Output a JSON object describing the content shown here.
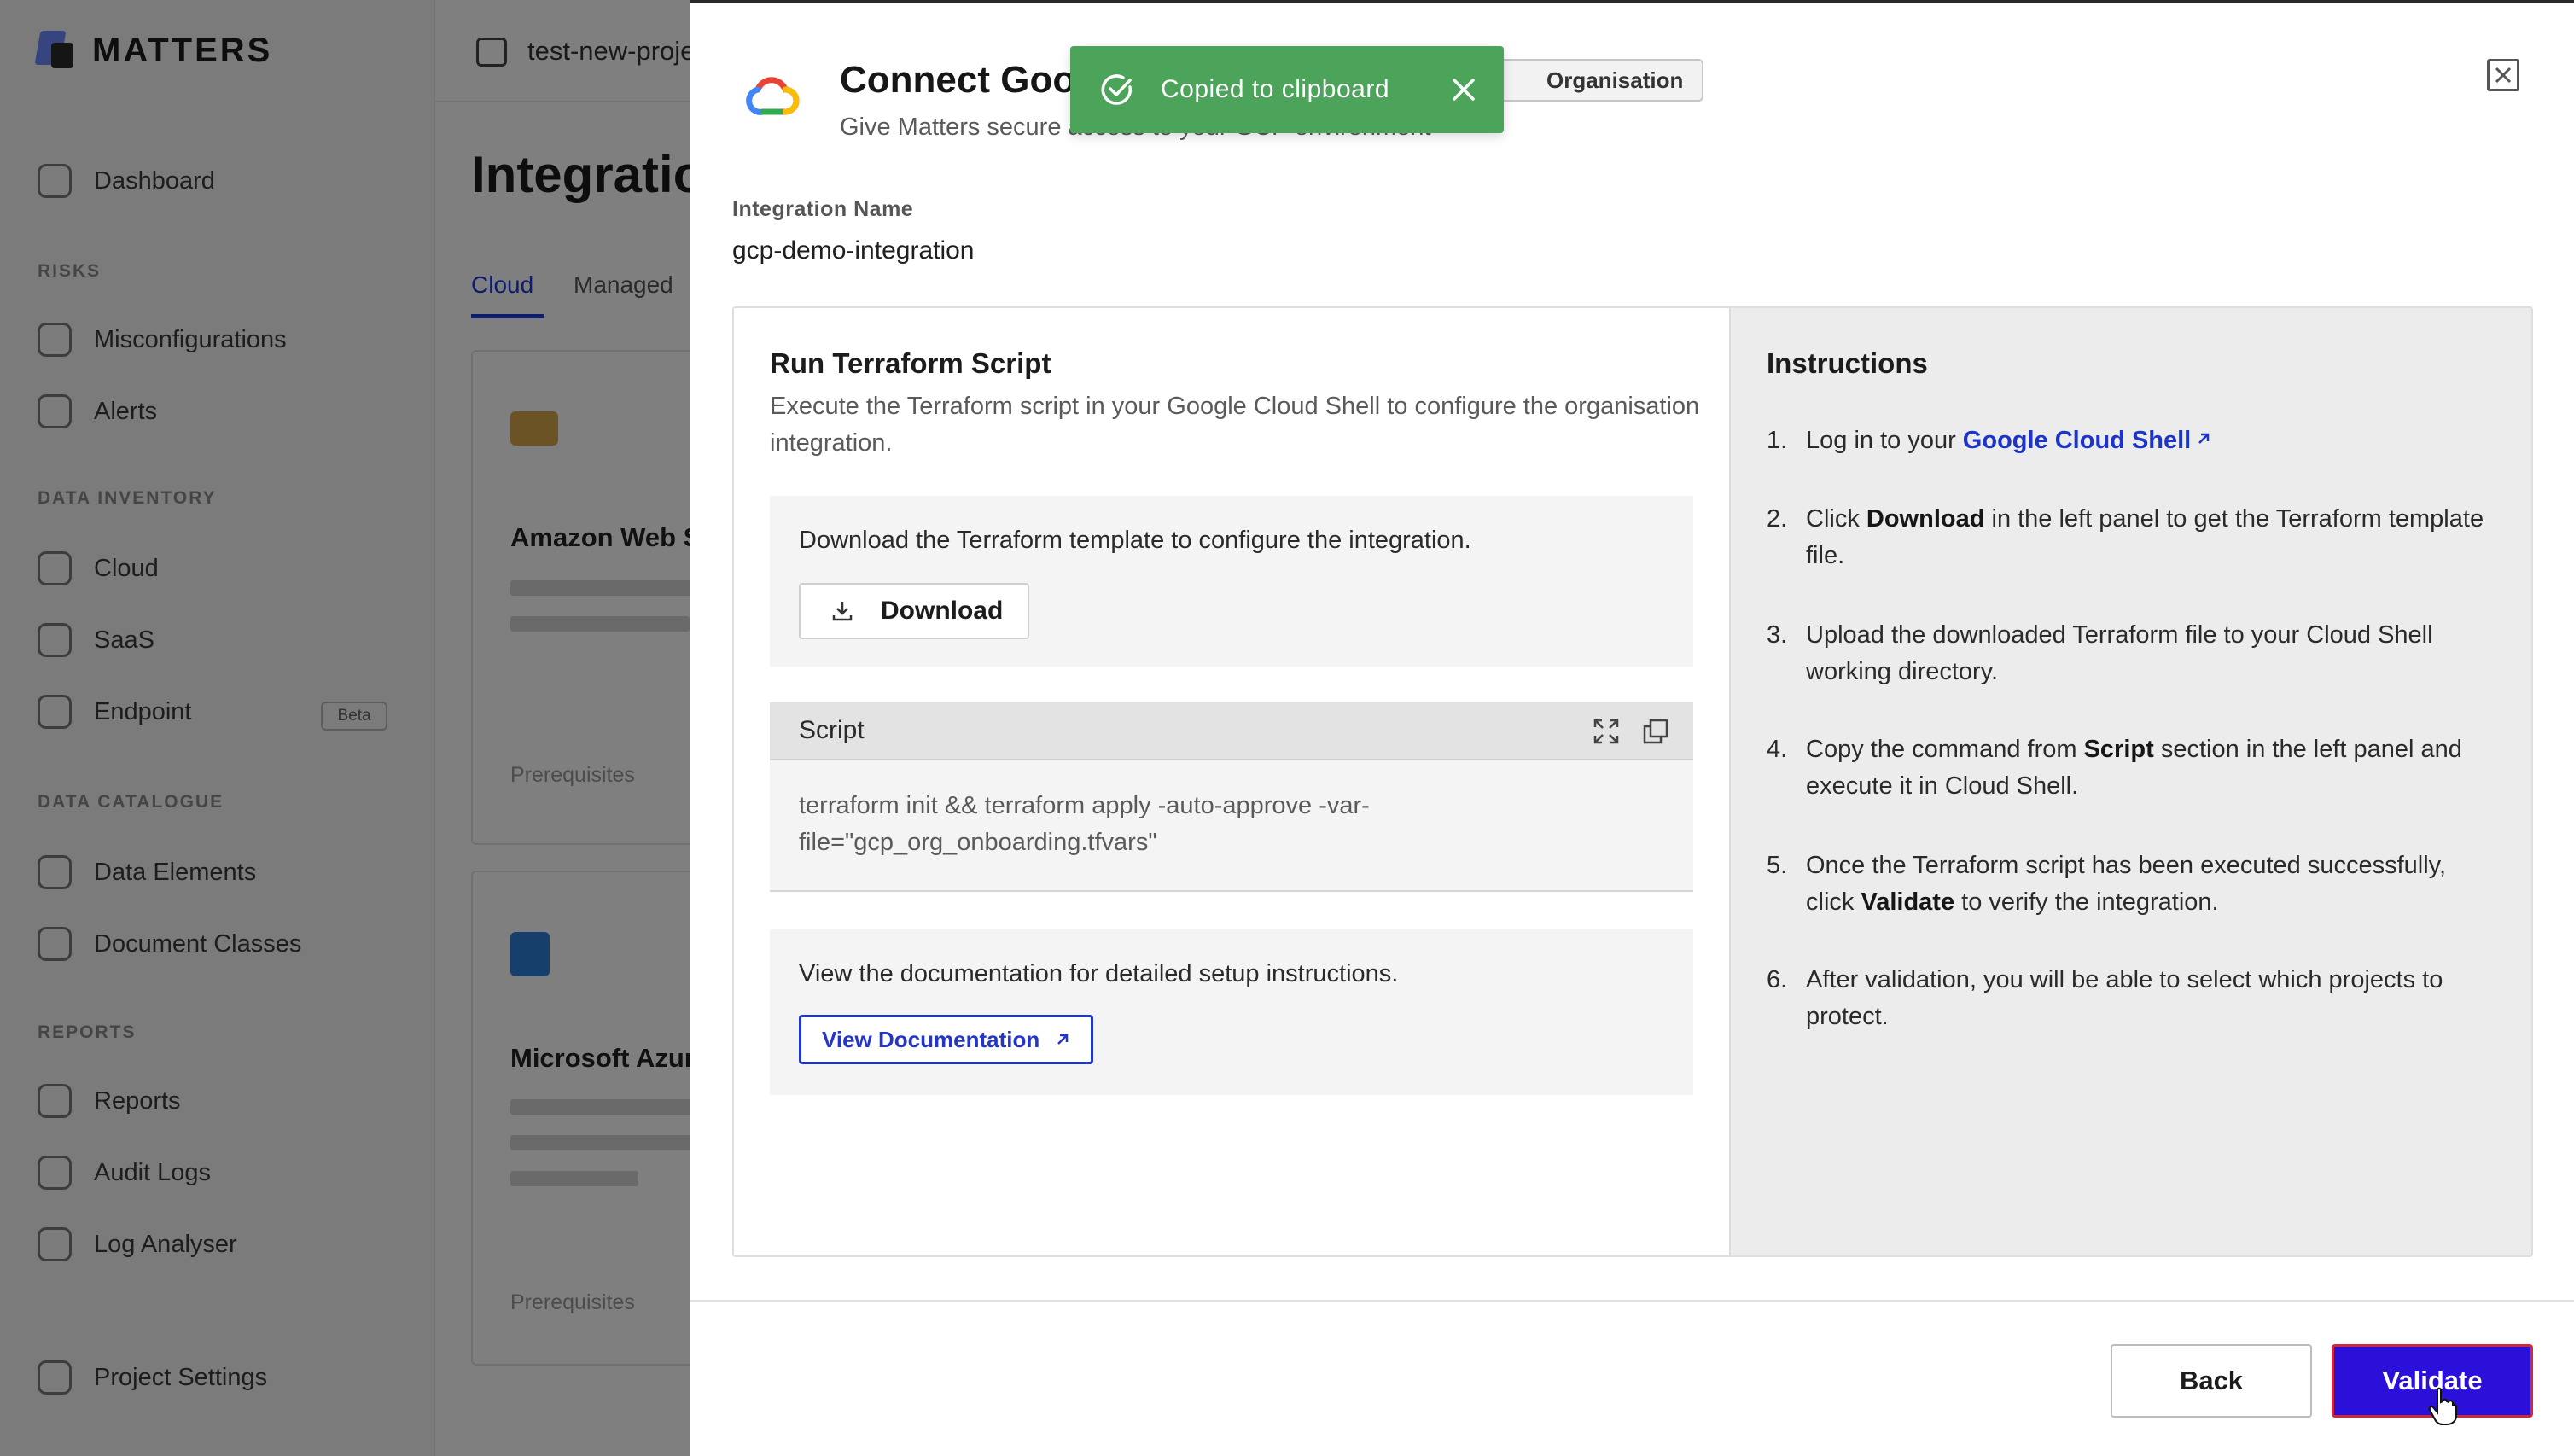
{
  "background": {
    "brand": "MATTERS",
    "topbar_text": "test-new-project",
    "page_title": "Integrations",
    "tabs": [
      {
        "label": "Cloud",
        "active": true
      },
      {
        "label": "Managed",
        "active": false
      }
    ],
    "sidebar": {
      "items": [
        {
          "label": "Dashboard"
        },
        {
          "section": "RISKS"
        },
        {
          "label": "Misconfigurations"
        },
        {
          "label": "Alerts"
        },
        {
          "section": "DATA INVENTORY"
        },
        {
          "label": "Cloud"
        },
        {
          "label": "SaaS"
        },
        {
          "label": "Endpoint",
          "badge": "Beta"
        },
        {
          "section": "DATA CATALOGUE"
        },
        {
          "label": "Data Elements"
        },
        {
          "label": "Document Classes"
        },
        {
          "section": "REPORTS"
        },
        {
          "label": "Reports"
        },
        {
          "label": "Audit Logs"
        },
        {
          "label": "Log Analyser"
        },
        {
          "label": "Project Settings"
        }
      ]
    },
    "cards": [
      {
        "title": "Amazon Web Services",
        "footer": "Prerequisites"
      },
      {
        "title": "Microsoft Azure",
        "footer": "Prerequisites"
      }
    ]
  },
  "drawer": {
    "title": "Connect Google Cloud Platform",
    "scope_badge": "Organisation",
    "subtitle": "Give Matters secure access to your GCP environment",
    "integration_name_label": "Integration Name",
    "integration_name_value": "gcp-demo-integration",
    "left": {
      "title": "Run Terraform Script",
      "description": "Execute the Terraform script in your Google Cloud Shell to configure the organisation integration.",
      "download_text": "Download the Terraform template to configure the integration.",
      "download_label": "Download",
      "script_label": "Script",
      "script_code": "terraform init && terraform apply -auto-approve -var-file=\"gcp_org_onboarding.tfvars\"",
      "docs_text": "View the documentation for detailed setup instructions.",
      "docs_label": "View Documentation"
    },
    "right": {
      "title": "Instructions",
      "steps": [
        {
          "num": "1.",
          "pre": "Log in to your ",
          "link": "Google Cloud Shell"
        },
        {
          "num": "2.",
          "pre": "Click ",
          "bold": "Download",
          "post": " in the left panel to get the Terraform template file."
        },
        {
          "num": "3.",
          "pre": "Upload the downloaded Terraform file to your Cloud Shell working directory."
        },
        {
          "num": "4.",
          "pre": "Copy the command from ",
          "bold": "Script",
          "post": " section in the left panel and execute it in Cloud Shell."
        },
        {
          "num": "5.",
          "pre": "Once the Terraform script has been executed successfully, click ",
          "bold": "Validate",
          "post": " to verify the integration."
        },
        {
          "num": "6.",
          "pre": "After validation, you will be able to select which projects to protect."
        }
      ]
    },
    "footer": {
      "back_label": "Back",
      "validate_label": "Validate"
    }
  },
  "toast": {
    "message": "Copied to clipboard"
  },
  "colors": {
    "primary": "#2a10d9",
    "link": "#1d34c9",
    "toast_bg": "#4ca35a",
    "focus_ring": "#d1273d"
  },
  "icons": [
    "google-cloud-logo",
    "close-icon",
    "download-icon",
    "expand-icon",
    "copy-icon",
    "external-link-icon",
    "check-circle-icon",
    "pointer-cursor"
  ]
}
